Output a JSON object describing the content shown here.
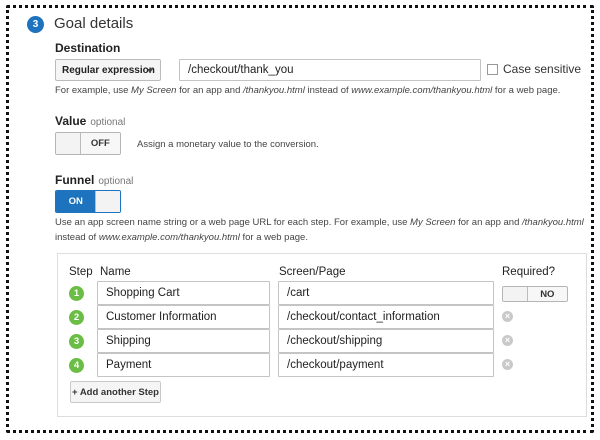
{
  "section": {
    "number": "3",
    "title": "Goal details"
  },
  "destination": {
    "label": "Destination",
    "match_type": "Regular expression",
    "value": "/checkout/thank_you",
    "case_sensitive_label": "Case sensitive",
    "case_sensitive_checked": false,
    "help_prefix": "For example, use ",
    "help_example_app": "My Screen",
    "help_middle": " for an app and ",
    "help_example_page": "/thankyou.html",
    "help_middle2": " instead of ",
    "help_example_url": "www.example.com/thankyou.html",
    "help_suffix": " for a web page."
  },
  "value": {
    "label": "Value",
    "optional": "optional",
    "toggle_state": "OFF",
    "help": "Assign a monetary value to the conversion."
  },
  "funnel": {
    "label": "Funnel",
    "optional": "optional",
    "toggle_state": "ON",
    "help_line1_prefix": "Use an app screen name string or a web page URL for each step. For example, use ",
    "help_line1_example_app": "My Screen",
    "help_line1_middle": " for an app and ",
    "help_line1_example_page": "/thankyou.html",
    "help_line2_prefix": "instead of ",
    "help_line2_example_url": "www.example.com/thankyou.html",
    "help_line2_suffix": " for a web page.",
    "columns": {
      "step": "Step",
      "name": "Name",
      "screen": "Screen/Page",
      "required": "Required?"
    },
    "steps": [
      {
        "number": "1",
        "name": "Shopping Cart",
        "screen": "/cart",
        "required": "NO"
      },
      {
        "number": "2",
        "name": "Customer Information",
        "screen": "/checkout/contact_information"
      },
      {
        "number": "3",
        "name": "Shipping",
        "screen": "/checkout/shipping"
      },
      {
        "number": "4",
        "name": "Payment",
        "screen": "/checkout/payment"
      }
    ],
    "add_step_label": "+ Add another Step"
  },
  "colors": {
    "accent_blue": "#1e73be",
    "step_green": "#6cbd45",
    "remove_grey": "#c9c9c9"
  }
}
